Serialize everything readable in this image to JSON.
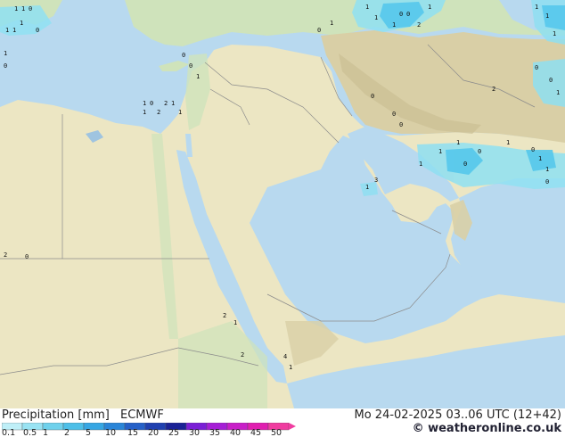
{
  "legend": {
    "title": "Precipitation [mm]",
    "model": "ECMWF",
    "scale_ticks": [
      "0.1",
      "0.5",
      "1",
      "2",
      "5",
      "10",
      "15",
      "20",
      "25",
      "30",
      "35",
      "40",
      "45",
      "50"
    ],
    "scale_colors": [
      "#bfeff8",
      "#99e3f3",
      "#6fd1ec",
      "#4dbfe8",
      "#36a6e3",
      "#2a85d8",
      "#2560c8",
      "#1f40b0",
      "#1a2296",
      "#7a1fd6",
      "#a51fd6",
      "#c81fc8",
      "#e01fb0",
      "#f03ca0"
    ]
  },
  "valid_time": "Mo 24-02-2025 03..06 UTC (12+42)",
  "credit": "© weatheronline.co.uk",
  "colors": {
    "sea": "#b8d9ef",
    "land_green": "#cfe3bb",
    "desert": "#ece6c3",
    "mountain": "#d9cfa6",
    "precip_light": "#8fe0f2",
    "precip_mid": "#55c8ec"
  },
  "precip_labels": [
    "1",
    "1",
    "0",
    "1",
    "1",
    "1",
    "0",
    "1",
    "0",
    "1",
    "0",
    "2",
    "1",
    "1",
    "2",
    "1",
    "0",
    "0",
    "1",
    "0",
    "1",
    "1",
    "1",
    "0",
    "0",
    "1",
    "1",
    "2",
    "1",
    "1",
    "1",
    "0",
    "0",
    "1",
    "2",
    "0",
    "0",
    "0",
    "1",
    "1",
    "0",
    "1",
    "0",
    "1",
    "1",
    "0",
    "1",
    "0",
    "1",
    "3",
    "2",
    "1",
    "2",
    "4",
    "1",
    "2",
    "0"
  ]
}
